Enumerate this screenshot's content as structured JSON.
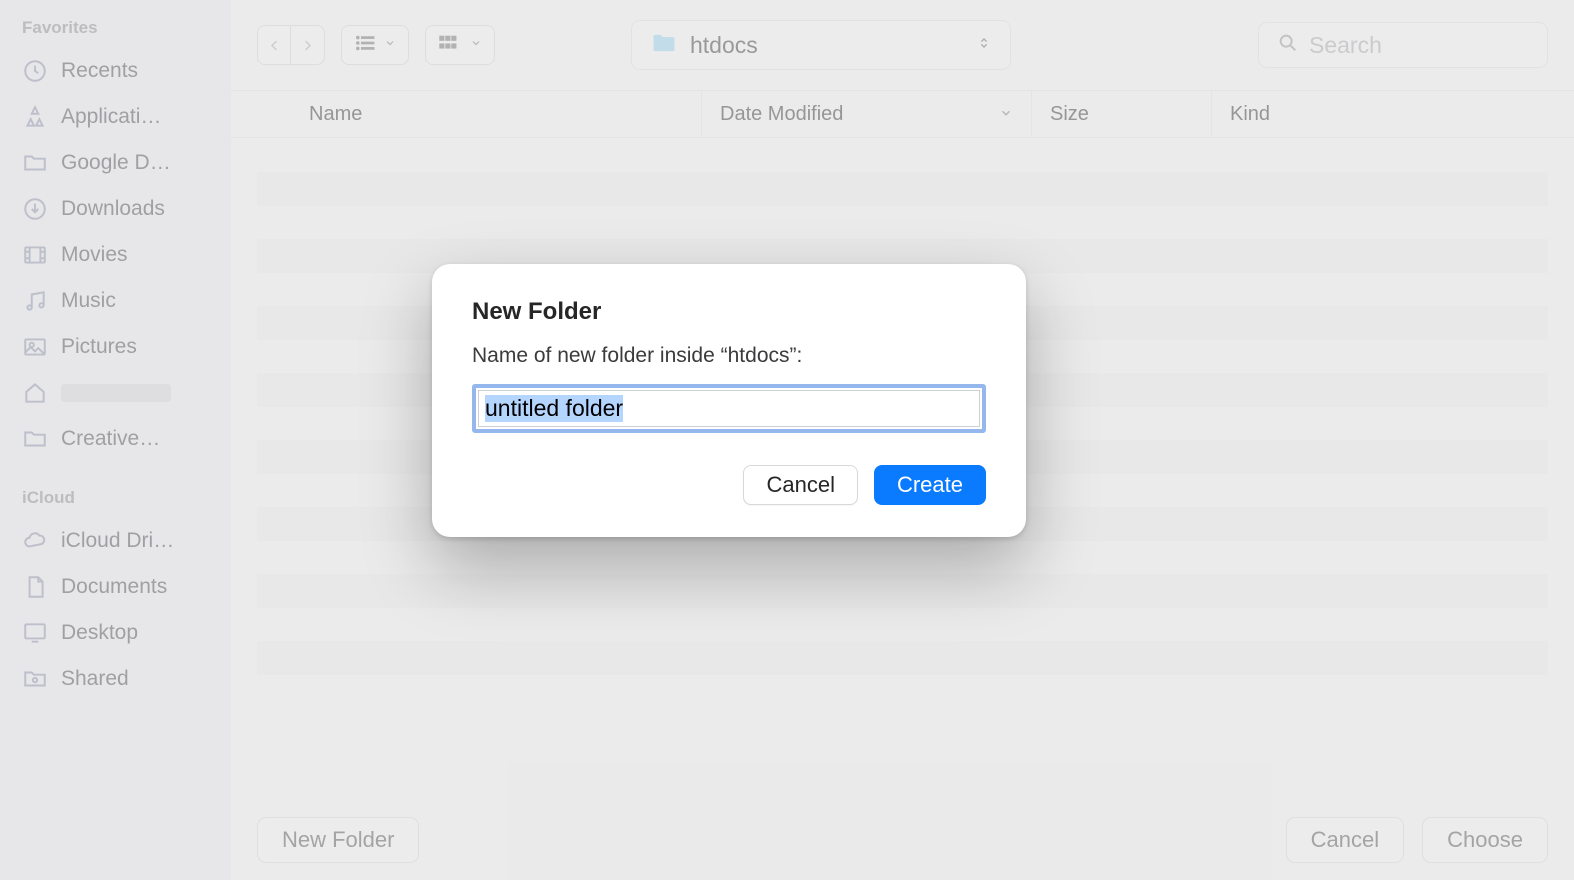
{
  "sidebar": {
    "section1_header": "Favorites",
    "section2_header": "iCloud",
    "favorites": [
      {
        "label": "Recents"
      },
      {
        "label": "Applicati…"
      },
      {
        "label": "Google D…"
      },
      {
        "label": "Downloads"
      },
      {
        "label": "Movies"
      },
      {
        "label": "Music"
      },
      {
        "label": "Pictures"
      },
      {
        "label": ""
      },
      {
        "label": "Creative…"
      }
    ],
    "icloud": [
      {
        "label": "iCloud Dri…"
      },
      {
        "label": "Documents"
      },
      {
        "label": "Desktop"
      },
      {
        "label": "Shared"
      }
    ]
  },
  "toolbar": {
    "current_folder": "htdocs",
    "search_placeholder": "Search"
  },
  "columns": {
    "name": "Name",
    "date_modified": "Date Modified",
    "size": "Size",
    "kind": "Kind"
  },
  "bottom_bar": {
    "new_folder": "New Folder",
    "cancel": "Cancel",
    "choose": "Choose"
  },
  "modal": {
    "title": "New Folder",
    "subtitle": "Name of new folder inside “htdocs”:",
    "input_value": "untitled folder",
    "cancel_label": "Cancel",
    "create_label": "Create"
  }
}
